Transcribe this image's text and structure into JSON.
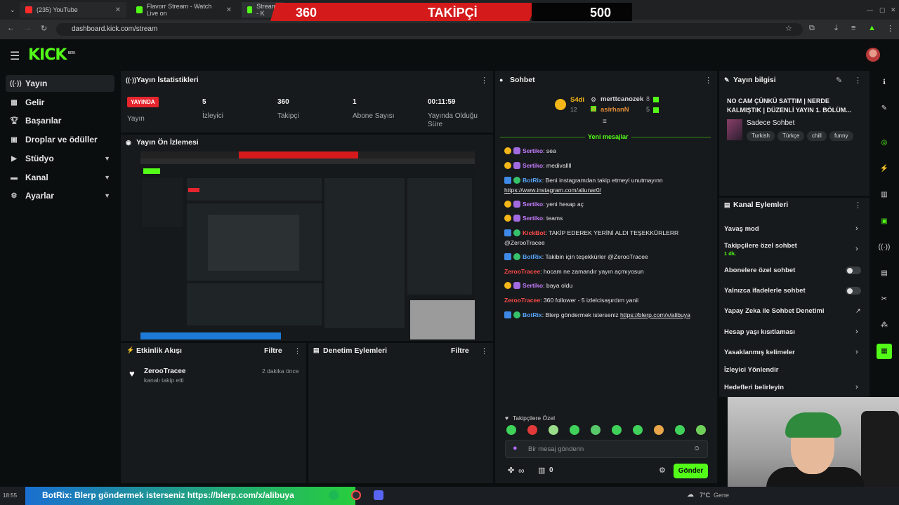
{
  "browser": {
    "tabs": [
      {
        "title": "(235) YouTube"
      },
      {
        "title": "Flavorr Stream - Watch Live on"
      },
      {
        "title": "Stream - K"
      }
    ],
    "url": "dashboard.kick.com/stream"
  },
  "banner": {
    "current": "360",
    "label": "TAKİPÇİ",
    "goal": "500"
  },
  "brand": {
    "logo": "KICK",
    "beta": "BETA"
  },
  "sidebar": {
    "items": [
      {
        "label": "Yayın",
        "icon": "broadcast-icon"
      },
      {
        "label": "Gelir",
        "icon": "revenue-icon"
      },
      {
        "label": "Başarılar",
        "icon": "trophy-icon"
      },
      {
        "label": "Droplar ve ödüller",
        "icon": "gift-icon"
      },
      {
        "label": "Stüdyo",
        "icon": "studio-icon"
      },
      {
        "label": "Kanal",
        "icon": "channel-icon"
      },
      {
        "label": "Ayarlar",
        "icon": "gear-icon"
      }
    ]
  },
  "stats": {
    "title": "Yayın İstatistikleri",
    "live_label": "YAYINDA",
    "live_caption": "Yayın",
    "items": [
      {
        "value": "5",
        "label": "İzleyici"
      },
      {
        "value": "360",
        "label": "Takipçi"
      },
      {
        "value": "1",
        "label": "Abone Sayısı"
      },
      {
        "value": "00:11:59",
        "label": "Yayında Olduğu Süre"
      }
    ]
  },
  "preview": {
    "title": "Yayın Ön İzlemesi"
  },
  "activity": {
    "title": "Etkinlik Akışı",
    "filter": "Filtre",
    "events": [
      {
        "user": "ZerooTracee",
        "action": "kanalı takip etti",
        "time": "2 dakika önce"
      }
    ]
  },
  "moderation": {
    "title": "Denetim Eylemleri",
    "filter": "Filtre"
  },
  "chat": {
    "title": "Sohbet",
    "top": [
      {
        "name": "S4di",
        "count": "12"
      },
      {
        "name": "merttcanozek",
        "count": "8"
      },
      {
        "name": "asirhanN",
        "count": "5"
      }
    ],
    "new_messages": "Yeni mesajlar",
    "messages": [
      {
        "user": "Sertiko",
        "text": "sea"
      },
      {
        "user": "Sertiko",
        "text": "medivallll"
      },
      {
        "user": "BotRix",
        "text": "Beni instagramdan takip etmeyi unutmayınn",
        "link": "https://www.instagram.com/aliunar0/"
      },
      {
        "user": "Sertiko",
        "text": "yeni hesap aç"
      },
      {
        "user": "Sertiko",
        "text": "teams"
      },
      {
        "user": "KickBot",
        "text": "TAKİP EDEREK YERİNİ ALDI TEŞEKKÜRLERR @ZerooTracee"
      },
      {
        "user": "BotRix",
        "text": "Takibin için teşekkürler @ZerooTracee"
      },
      {
        "user": "ZerooTracee",
        "text": "hocam ne zamandır yayın açmıyosun"
      },
      {
        "user": "Sertiko",
        "text": "baya oldu"
      },
      {
        "user": "ZerooTracee",
        "text": "360 follower - 5 izlelcisaşırdım yanii"
      },
      {
        "user": "BotRix",
        "text": "Blerp göndermek isterseniz",
        "link": "https://blerp.com/x/alibuya"
      }
    ],
    "followers_only": "Takipçilere Özel",
    "placeholder": "Bir mesaj gönderin",
    "points": "∞",
    "gifts": "0",
    "send": "Gönder"
  },
  "stream_info": {
    "title": "Yayın bilgisi",
    "stream_title": "NO CAM ÇÜNKÜ SATTIM | NERDE KALMIŞTIK | DÜZENLİ YAYIN 1. BÖLÜM...",
    "category": "Sadece Sohbet",
    "tags": [
      "Turkish",
      "Türkçe",
      "chill",
      "funny"
    ]
  },
  "channel_actions": {
    "title": "Kanal Eylemleri",
    "items": [
      {
        "label": "Yavaş mod",
        "control": "chevron"
      },
      {
        "label": "Takipçilere özel sohbet",
        "sub": "1 dk.",
        "control": "chevron"
      },
      {
        "label": "Abonelere özel sohbet",
        "control": "toggle"
      },
      {
        "label": "Yalnızca ifadelerle sohbet",
        "control": "toggle"
      },
      {
        "label": "Yapay Zeka ile Sohbet Denetimi",
        "control": "external"
      },
      {
        "label": "Hesap yaşı kısıtlaması",
        "control": "chevron"
      },
      {
        "label": "Yasaklanmış kelimeler",
        "control": "chevron"
      },
      {
        "label": "İzleyici Yönlendir",
        "control": "none"
      },
      {
        "label": "Hedefleri belirleyin",
        "control": "chevron"
      }
    ]
  },
  "ticker": {
    "user": "BotRix",
    "text": ": Blerp göndermek isterseniz https://blerp.com/x/alibuya"
  },
  "taskbar": {
    "time": "18:55",
    "weather": "7°C",
    "weather_text": "Gene"
  }
}
